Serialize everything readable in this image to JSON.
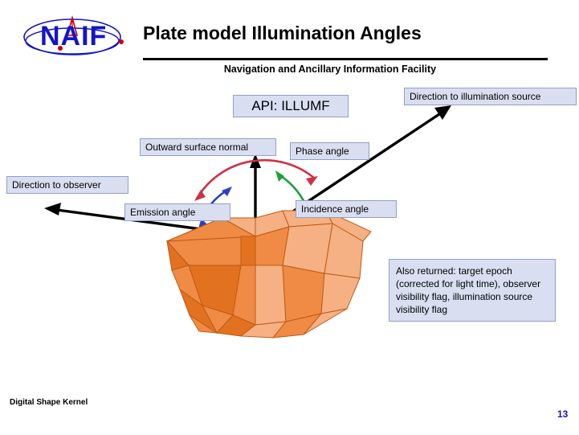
{
  "logo": {
    "text": "NAIF",
    "icon": "naif-orbit-logo"
  },
  "header": {
    "title": "Plate model Illumination Angles",
    "subtitle": "Navigation and Ancillary Information Facility"
  },
  "labels": {
    "api": "API: ILLUMF",
    "direction_to_illumination_source": "Direction to illumination source",
    "outward_surface_normal": "Outward surface normal",
    "phase_angle": "Phase angle",
    "direction_to_observer": "Direction to observer",
    "emission_angle": "Emission angle",
    "incidence_angle": "Incidence angle",
    "also_returned": "Also returned: target epoch (corrected for light time), observer visibility flag, illumination source visibility flag"
  },
  "footer": {
    "left": "Digital Shape Kernel",
    "page_number": "13"
  },
  "colors": {
    "logo_blue": "#1414c8",
    "logo_red": "#cc0000",
    "label_fill": "#d9dff0",
    "label_border": "#8fa0c8",
    "phase_arc": "#cc3344",
    "incidence_arc": "#1aa03c",
    "emission_arc": "#2a3ecb",
    "shape_fill_light": "#f5b183",
    "shape_fill_mid": "#ef8b44",
    "shape_fill_dark": "#e2721f",
    "shape_outline": "#c05a16",
    "page_number_color": "#1414c8"
  }
}
